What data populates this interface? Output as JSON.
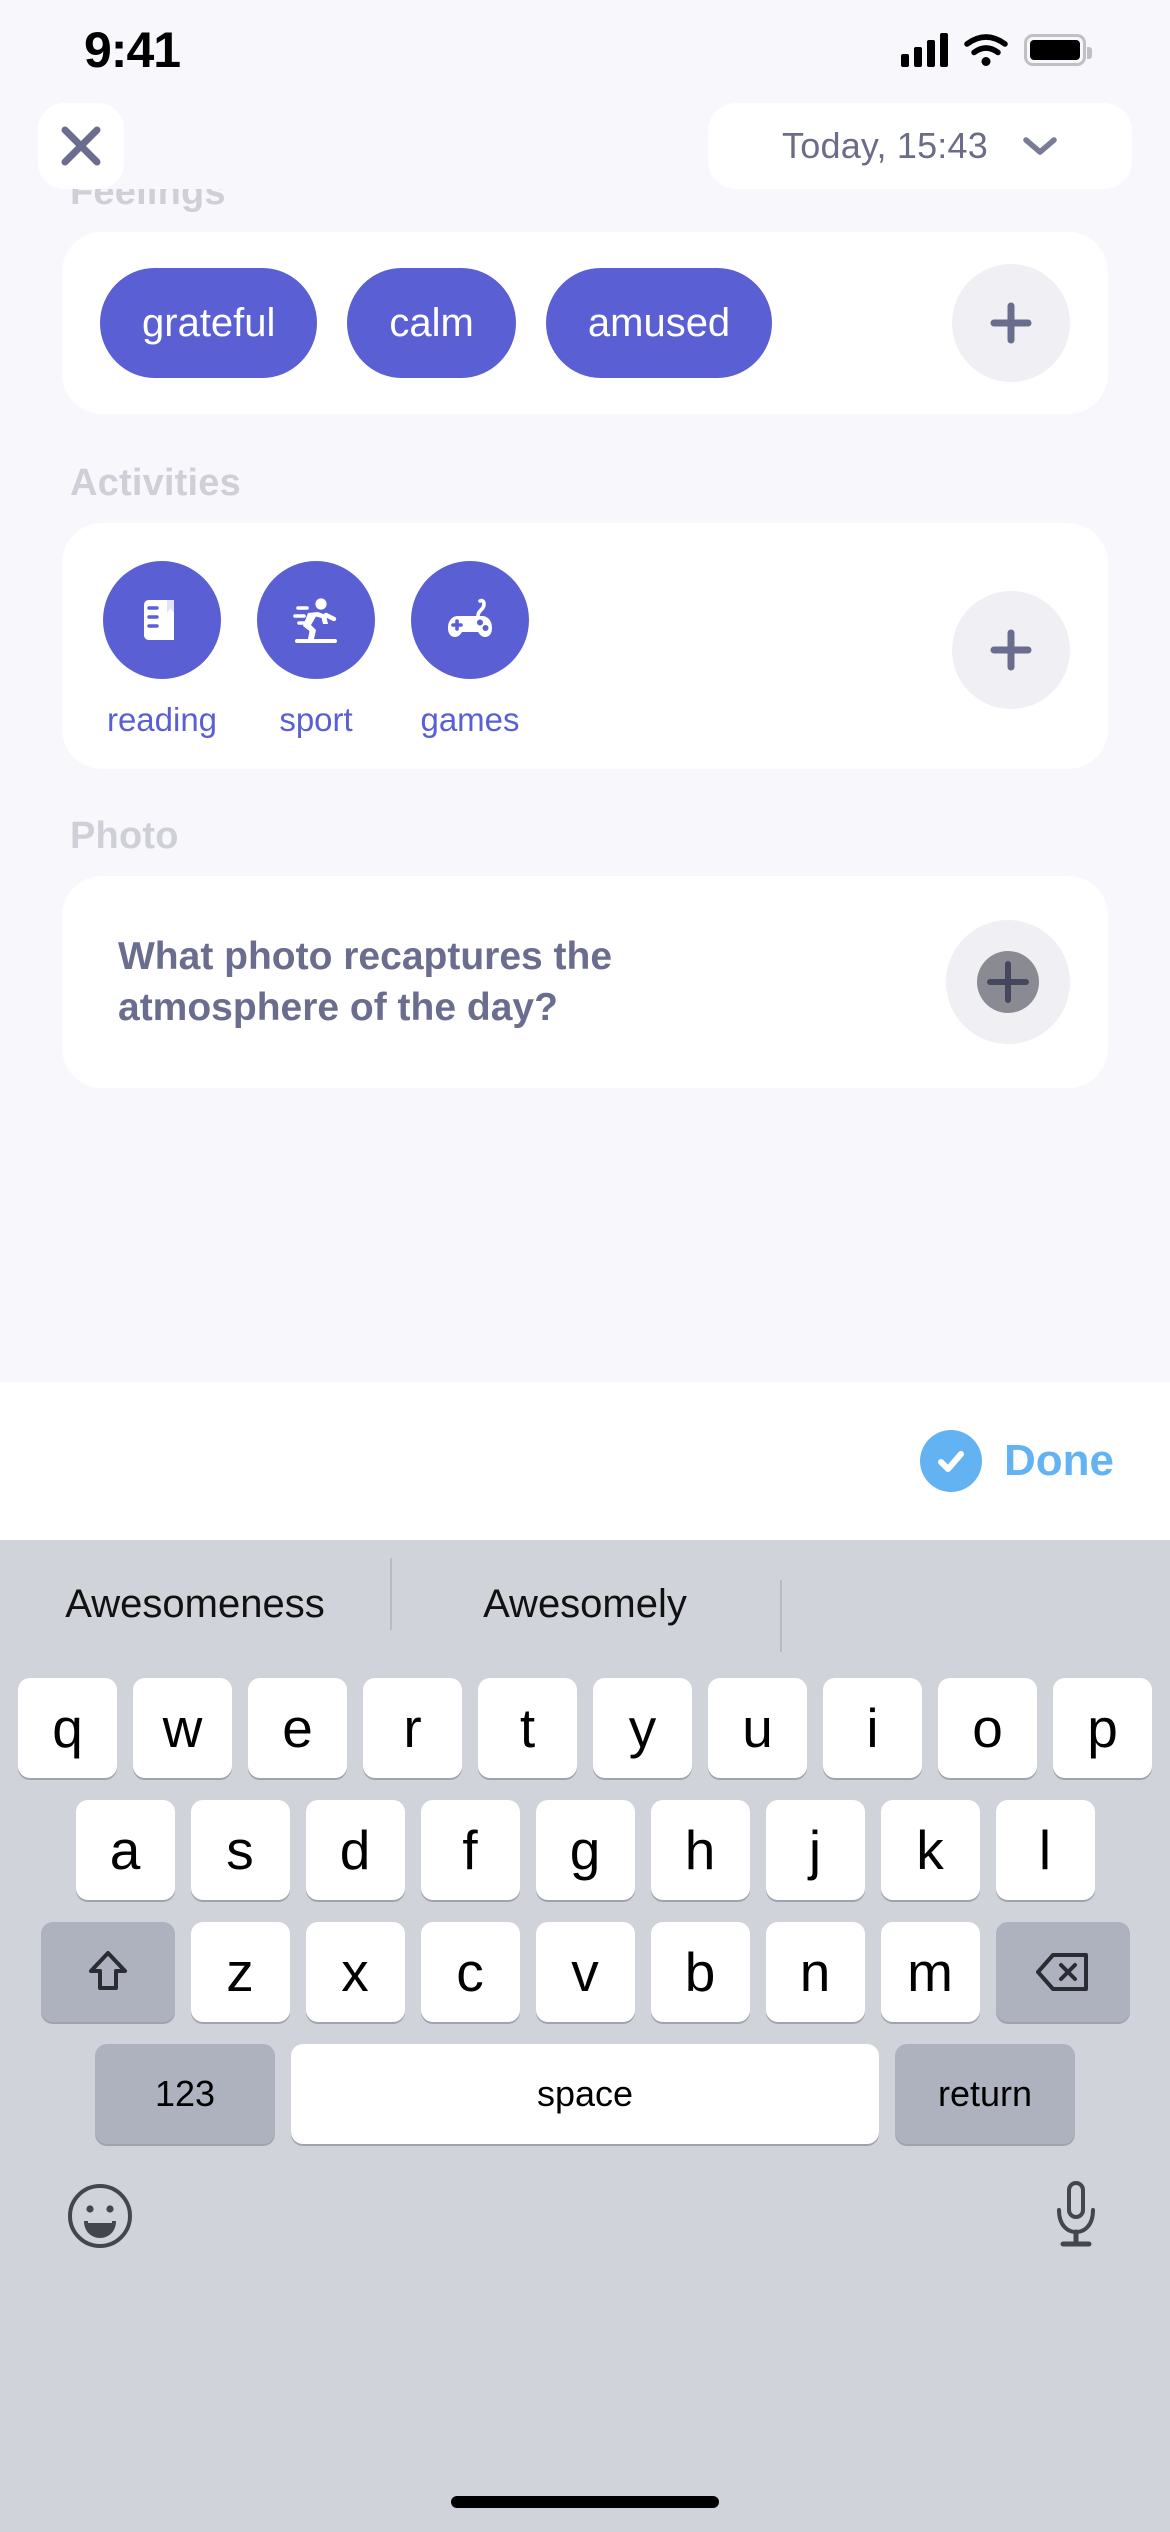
{
  "status_bar": {
    "time": "9:41",
    "signal_icon": "cellular-signal-icon",
    "wifi_icon": "wifi-icon",
    "battery_icon": "battery-icon"
  },
  "header": {
    "close_icon": "close-icon",
    "date_label": "Today, 15:43",
    "chevron_icon": "chevron-down-icon"
  },
  "sections": {
    "feelings": {
      "label": "Feelings",
      "chips": [
        "grateful",
        "calm",
        "amused"
      ],
      "add_label": "+"
    },
    "activities": {
      "label": "Activities",
      "items": [
        {
          "label": "reading",
          "icon": "book-icon"
        },
        {
          "label": "sport",
          "icon": "running-icon"
        },
        {
          "label": "games",
          "icon": "gamepad-icon"
        }
      ],
      "add_label": "+"
    },
    "photo": {
      "label": "Photo",
      "question": "What photo recaptures the atmosphere of the day?",
      "add_label": "+"
    }
  },
  "done_bar": {
    "label": "Done",
    "check_icon": "check-circle-icon"
  },
  "keyboard": {
    "suggestions": [
      "Awesomeness",
      "Awesomely",
      ""
    ],
    "row1": [
      "q",
      "w",
      "e",
      "r",
      "t",
      "y",
      "u",
      "i",
      "o",
      "p"
    ],
    "row2": [
      "a",
      "s",
      "d",
      "f",
      "g",
      "h",
      "j",
      "k",
      "l"
    ],
    "row3": [
      "z",
      "x",
      "c",
      "v",
      "b",
      "n",
      "m"
    ],
    "shift_icon": "shift-arrow-icon",
    "backspace_icon": "backspace-icon",
    "numeric_label": "123",
    "space_label": "space",
    "return_label": "return",
    "emoji_icon": "emoji-smiley-icon",
    "mic_icon": "microphone-icon"
  },
  "colors": {
    "accent_purple": "#5a5fd4",
    "done_blue": "#63b3f2",
    "slate_text": "#6b6d8e",
    "muted_label": "#cfcfd8",
    "page_bg": "#f8f7fb",
    "keyboard_bg": "#d1d3da"
  }
}
